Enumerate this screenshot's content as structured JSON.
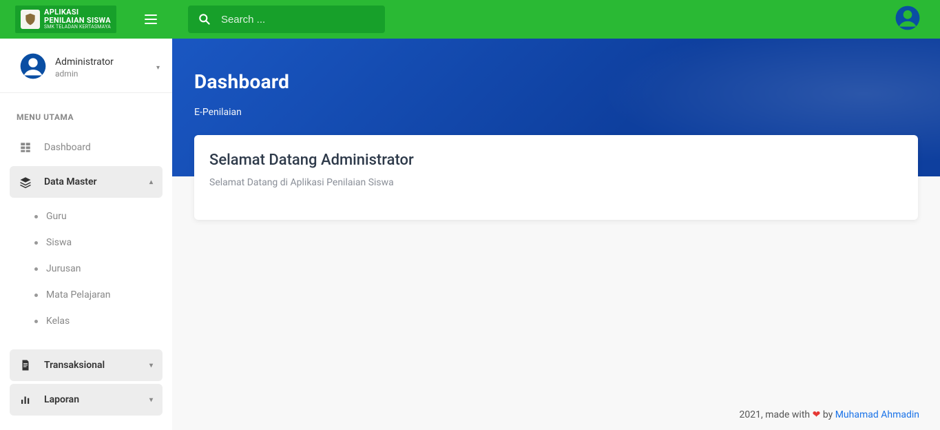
{
  "brand": {
    "line1": "APLIKASI",
    "line2": "PENILAIAN SISWA",
    "line3": "SMK TELADAN KERTASMAYA"
  },
  "search": {
    "placeholder": "Search ..."
  },
  "user": {
    "name": "Administrator",
    "role": "admin"
  },
  "sidebar": {
    "section_title": "MENU UTAMA",
    "items": [
      {
        "label": "Dashboard"
      },
      {
        "label": "Data Master"
      },
      {
        "label": "Transaksional"
      },
      {
        "label": "Laporan"
      }
    ],
    "data_master_sub": [
      {
        "label": "Guru"
      },
      {
        "label": "Siswa"
      },
      {
        "label": "Jurusan"
      },
      {
        "label": "Mata Pelajaran"
      },
      {
        "label": "Kelas"
      }
    ]
  },
  "page": {
    "title": "Dashboard",
    "breadcrumb": "E-Penilaian",
    "card_title": "Selamat Datang Administrator",
    "card_body": "Selamat Datang di Aplikasi Penilaian Siswa"
  },
  "footer": {
    "year": "2021",
    "made_with": ", made with ",
    "by": " by ",
    "author": "Muhamad Ahmadin"
  }
}
